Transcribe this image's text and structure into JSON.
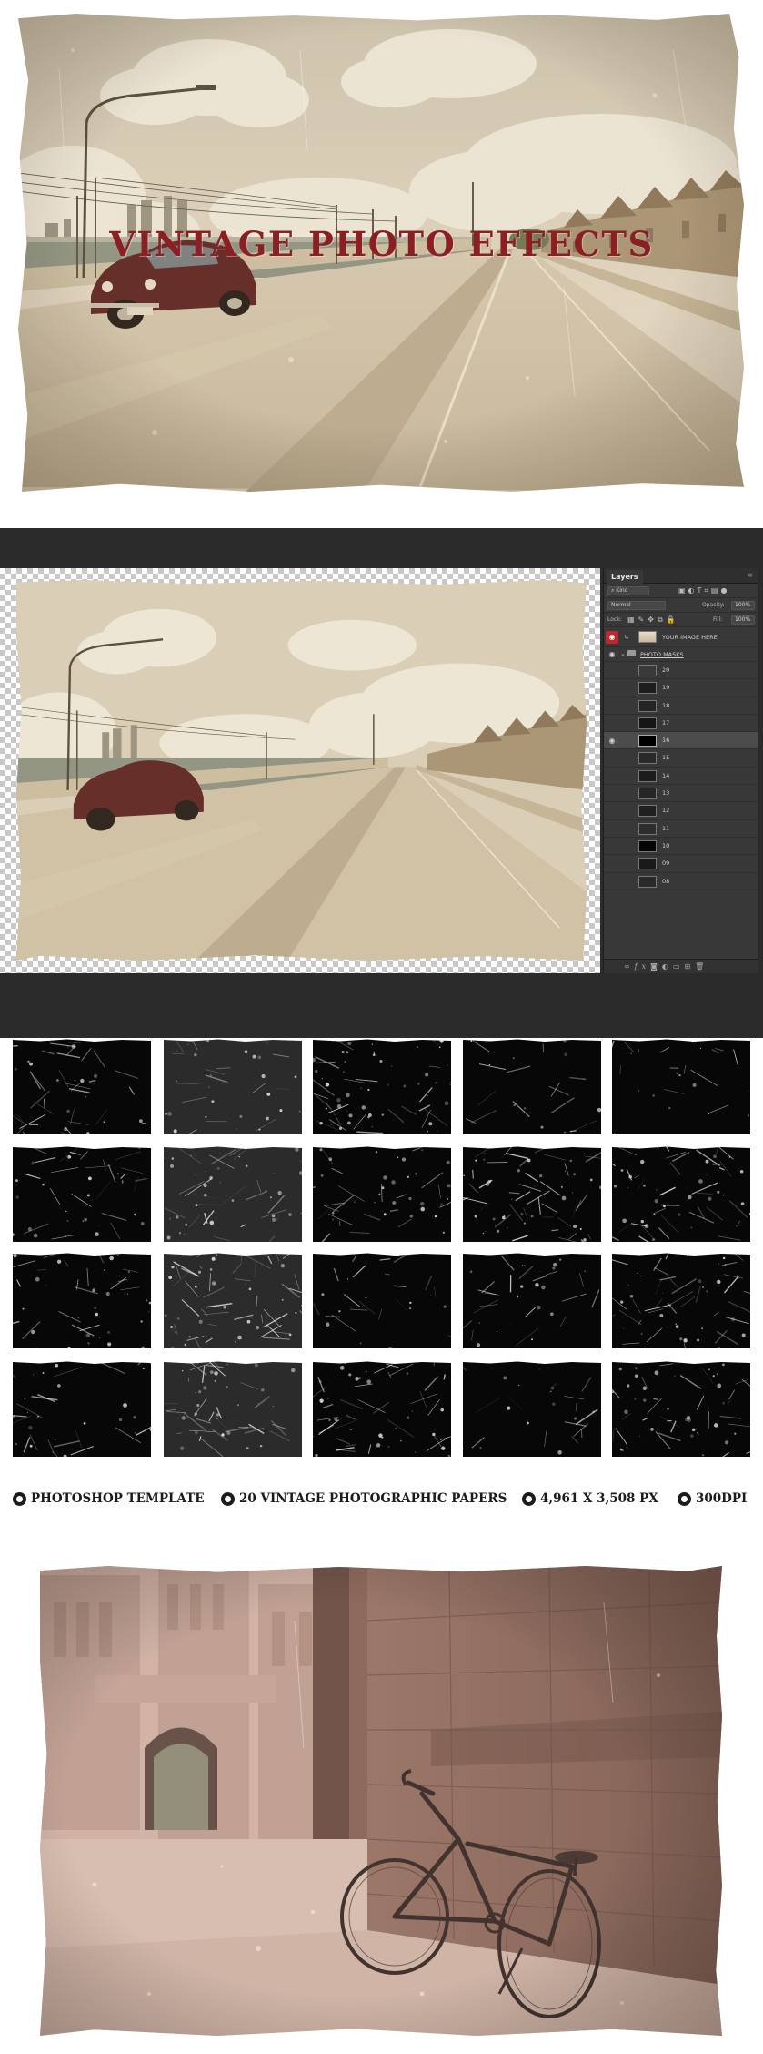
{
  "hero": {
    "title": "VINTAGE PHOTO EFFECTS",
    "colors": {
      "title": "#8a1f24",
      "paper": "#efe6d3",
      "car": "#5b1f22"
    }
  },
  "photoshop": {
    "layers_panel": {
      "tab_label": "Layers",
      "filter_kind": "Kind",
      "blend_mode": "Normal",
      "opacity_label": "Opacity:",
      "opacity_value": "100%",
      "lock_label": "Lock:",
      "fill_label": "Fill:",
      "fill_value": "100%",
      "layers": [
        {
          "name": "YOUR IMAGE HERE",
          "visible": true,
          "type": "image"
        },
        {
          "name": "PHOTO MASKS",
          "visible": true,
          "type": "group"
        },
        {
          "name": "20",
          "visible": false,
          "type": "mask"
        },
        {
          "name": "19",
          "visible": false,
          "type": "mask"
        },
        {
          "name": "18",
          "visible": false,
          "type": "mask"
        },
        {
          "name": "17",
          "visible": false,
          "type": "mask"
        },
        {
          "name": "16",
          "visible": true,
          "type": "mask",
          "selected": true
        },
        {
          "name": "15",
          "visible": false,
          "type": "mask"
        },
        {
          "name": "14",
          "visible": false,
          "type": "mask"
        },
        {
          "name": "13",
          "visible": false,
          "type": "mask"
        },
        {
          "name": "12",
          "visible": false,
          "type": "mask"
        },
        {
          "name": "11",
          "visible": false,
          "type": "mask"
        },
        {
          "name": "10",
          "visible": false,
          "type": "mask"
        },
        {
          "name": "09",
          "visible": false,
          "type": "mask"
        },
        {
          "name": "08",
          "visible": false,
          "type": "mask"
        }
      ]
    }
  },
  "features": [
    {
      "label": "PHOTOSHOP TEMPLATE"
    },
    {
      "label": "20 VINTAGE PHOTOGRAPHIC PAPERS"
    },
    {
      "label": "4,961 X 3,508 PX"
    },
    {
      "label": "300DPI"
    }
  ],
  "textures": {
    "count": 20,
    "columns": 5,
    "rows": 4
  }
}
